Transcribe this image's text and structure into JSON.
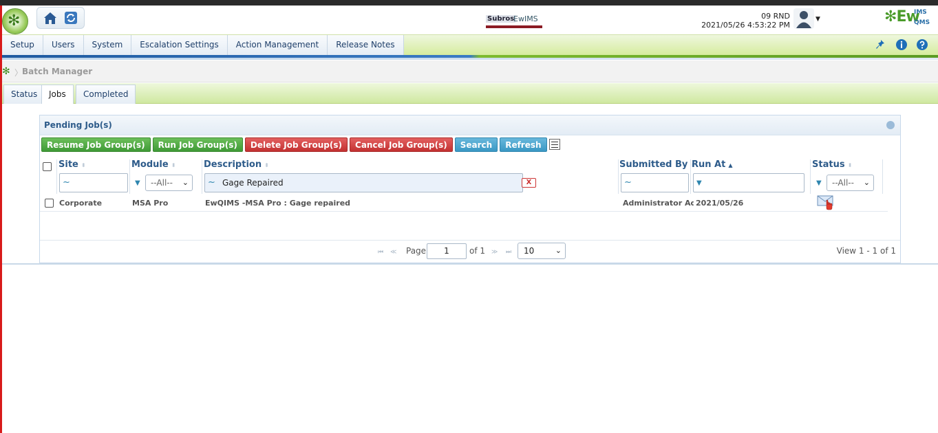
{
  "header": {
    "user_line1": "09 RND",
    "user_line2": "2021/05/26 4:53:22 PM",
    "center_logo_left": "Subros",
    "center_logo_right": "EwIMS",
    "brand": "Ew",
    "brand_sup": "IMS",
    "brand_sub": "QMS"
  },
  "menu": {
    "items": [
      "Setup",
      "Users",
      "System",
      "Escalation Settings",
      "Action Management",
      "Release Notes"
    ]
  },
  "breadcrumb": {
    "current": "Batch Manager"
  },
  "tabs": [
    "Status",
    "Jobs",
    "Completed"
  ],
  "panel": {
    "title": "Pending Job(s)",
    "buttons": {
      "resume": "Resume Job Group(s)",
      "run": "Run Job Group(s)",
      "delete": "Delete Job Group(s)",
      "cancel": "Cancel Job Group(s)",
      "search": "Search",
      "refresh": "Refresh"
    }
  },
  "grid": {
    "columns": {
      "site": "Site",
      "module": "Module",
      "description": "Description",
      "submitted_by": "Submitted By",
      "run_at": "Run At",
      "status": "Status"
    },
    "filters": {
      "tilde": "~",
      "all": "--All--",
      "description_value": "Gage Repaired",
      "clear": "X"
    },
    "rows": [
      {
        "site": "Corporate",
        "module": "MSA Pro",
        "description": "EwQIMS -MSA Pro : Gage repaired",
        "submitted_by": "Administrator Adm",
        "run_at": "2021/05/26"
      }
    ]
  },
  "pager": {
    "page_label": "Page",
    "page_value": "1",
    "of_label": "of 1",
    "page_size": "10",
    "view_text": "View 1 - 1 of 1"
  }
}
